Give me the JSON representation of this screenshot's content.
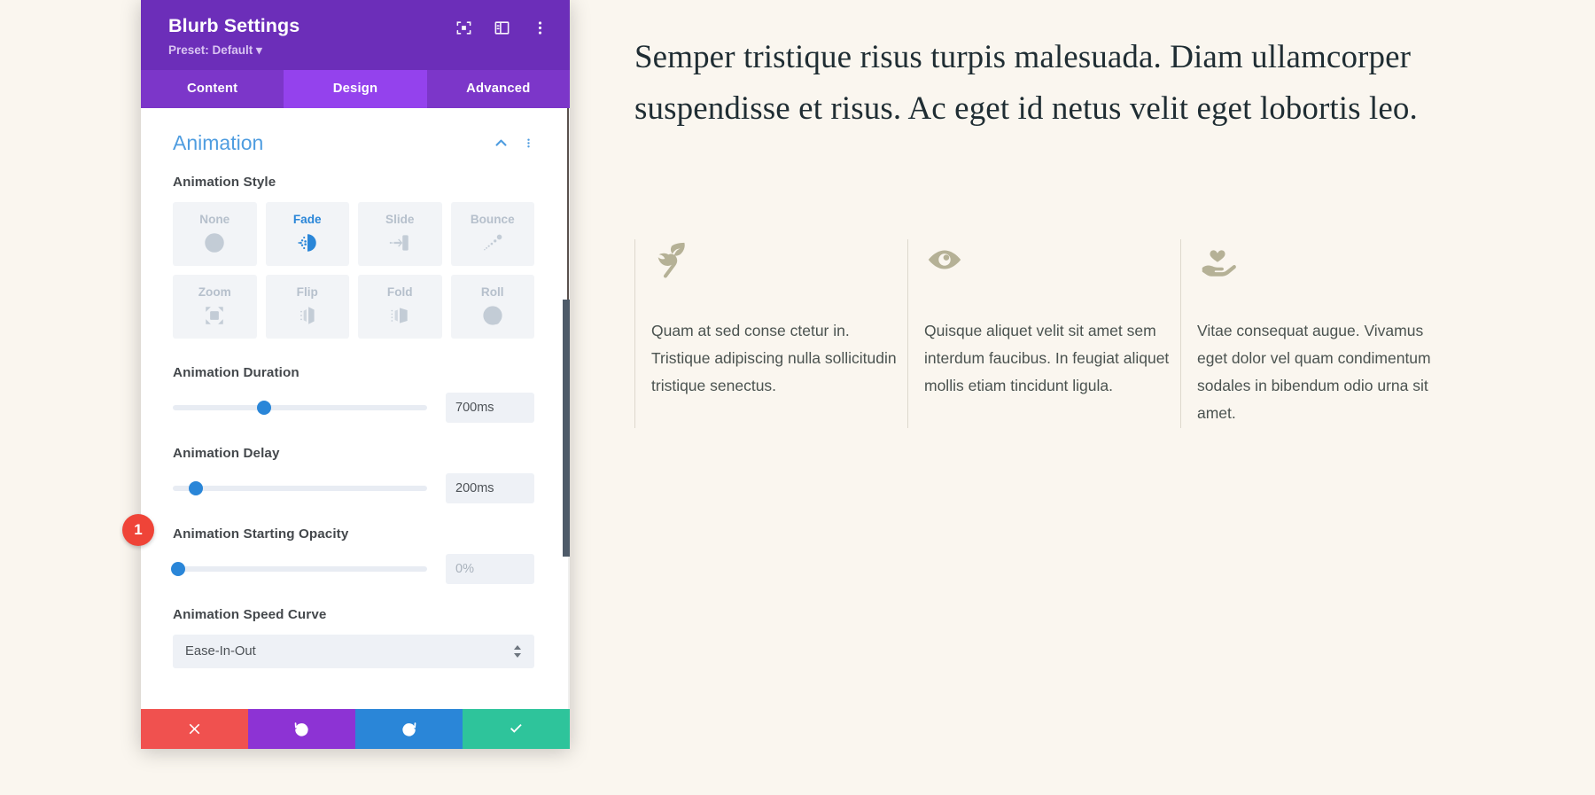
{
  "modal": {
    "title": "Blurb Settings",
    "preset": "Preset: Default ▾",
    "header_icons": [
      {
        "name": "focus-icon",
        "label": "focus"
      },
      {
        "name": "layout-panel-icon",
        "label": "layout"
      },
      {
        "name": "more-vertical-icon",
        "label": "more"
      }
    ],
    "tabs": [
      {
        "label": "Content",
        "active": false
      },
      {
        "label": "Design",
        "active": true
      },
      {
        "label": "Advanced",
        "active": false
      }
    ],
    "section": {
      "title": "Animation",
      "collapse_icon": "chevron-up-icon",
      "menu_icon": "more-vertical-icon"
    },
    "fields": {
      "animation_style_label": "Animation Style",
      "animation_styles": [
        {
          "label": "None",
          "icon": "no-entry-icon",
          "selected": false
        },
        {
          "label": "Fade",
          "icon": "fade-icon",
          "selected": true
        },
        {
          "label": "Slide",
          "icon": "slide-icon",
          "selected": false
        },
        {
          "label": "Bounce",
          "icon": "bounce-icon",
          "selected": false
        },
        {
          "label": "Zoom",
          "icon": "zoom-icon",
          "selected": false
        },
        {
          "label": "Flip",
          "icon": "flip-icon",
          "selected": false
        },
        {
          "label": "Fold",
          "icon": "fold-icon",
          "selected": false
        },
        {
          "label": "Roll",
          "icon": "roll-icon",
          "selected": false
        }
      ],
      "duration_label": "Animation Duration",
      "duration_value": "700ms",
      "duration_pct": 36,
      "delay_label": "Animation Delay",
      "delay_value": "200ms",
      "delay_pct": 9,
      "opacity_label": "Animation Starting Opacity",
      "opacity_value": "0%",
      "opacity_pct": 2,
      "speed_curve_label": "Animation Speed Curve",
      "speed_curve_value": "Ease-In-Out"
    },
    "footer": [
      {
        "name": "cancel-button",
        "icon": "close-icon"
      },
      {
        "name": "undo-button",
        "icon": "undo-icon"
      },
      {
        "name": "redo-button",
        "icon": "redo-icon"
      },
      {
        "name": "save-button",
        "icon": "check-icon"
      }
    ]
  },
  "annotation": {
    "step_number": "1"
  },
  "page": {
    "heading": "Semper tristique risus turpis malesuada. Diam ullamcorper suspendisse et risus. Ac eget id netus velit eget lobortis leo.",
    "blurbs": [
      {
        "icon": "leaf-branch-icon",
        "text": "Quam at sed conse ctetur in. Tristique adipiscing nulla sollicitudin tristique senectus."
      },
      {
        "icon": "eye-icon",
        "text": "Quisque aliquet velit sit amet sem interdum faucibus. In feugiat aliquet mollis etiam tincidunt ligula."
      },
      {
        "icon": "hand-heart-icon",
        "text": "Vitae consequat augue. Vivamus eget dolor vel quam condimentum sodales in bibendum odio urna sit amet."
      }
    ]
  },
  "colors": {
    "header_purple": "#6c2eb9",
    "tab_active": "#9442ed",
    "accent_blue": "#2a86d8",
    "section_blue": "#4f9de0",
    "badge_red": "#ef4438",
    "save_green": "#2ec49b",
    "page_bg": "#faf6ef"
  }
}
